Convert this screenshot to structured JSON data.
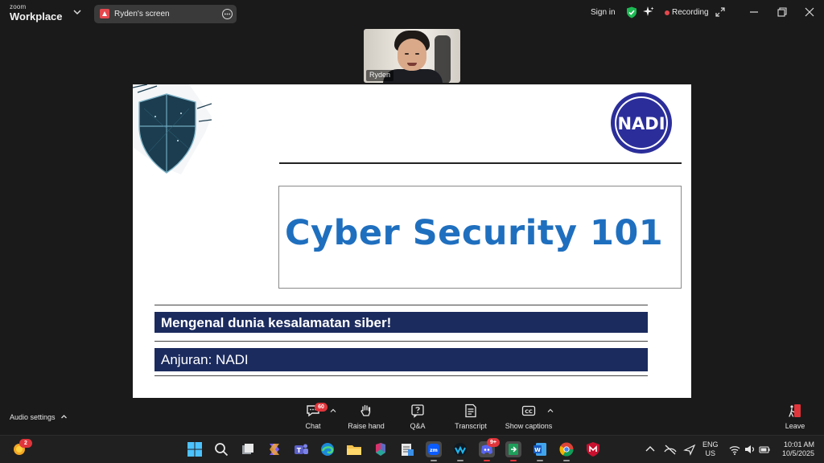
{
  "app": {
    "brand_line1": "zoom",
    "brand_line2": "Workplace",
    "share_label": "Ryden's screen",
    "sign_in": "Sign in",
    "recording_label": "Recording",
    "accent_color": "#0b5cff",
    "recording_color": "#e5484d"
  },
  "video": {
    "participant_name": "Ryden"
  },
  "slide": {
    "title": "Cyber Security 101",
    "subtitle": "Mengenal dunia kesalamatan siber!",
    "byline": "Anjuran: NADI",
    "logo_text": "NADI",
    "title_color": "#1f6fbf",
    "band_color": "#1b2b5e",
    "logo_color": "#2b2e9a"
  },
  "toolbar": {
    "audio_settings": "Audio settings",
    "chat": "Chat",
    "chat_badge": "60",
    "raise_hand": "Raise hand",
    "qa": "Q&A",
    "transcript": "Transcript",
    "show_captions": "Show captions",
    "leave": "Leave"
  },
  "taskbar": {
    "weather_badge": "2",
    "discord_badge": "9+",
    "lang_line1": "ENG",
    "lang_line2": "US",
    "time": "10:01 AM",
    "date": "10/5/2025",
    "apps": [
      "weather",
      "start",
      "search",
      "task-view",
      "copilot",
      "teams",
      "edge",
      "file-explorer",
      "m365",
      "notepad",
      "zoom",
      "webex",
      "discord",
      "app-green",
      "word",
      "chrome",
      "mcafee"
    ]
  }
}
